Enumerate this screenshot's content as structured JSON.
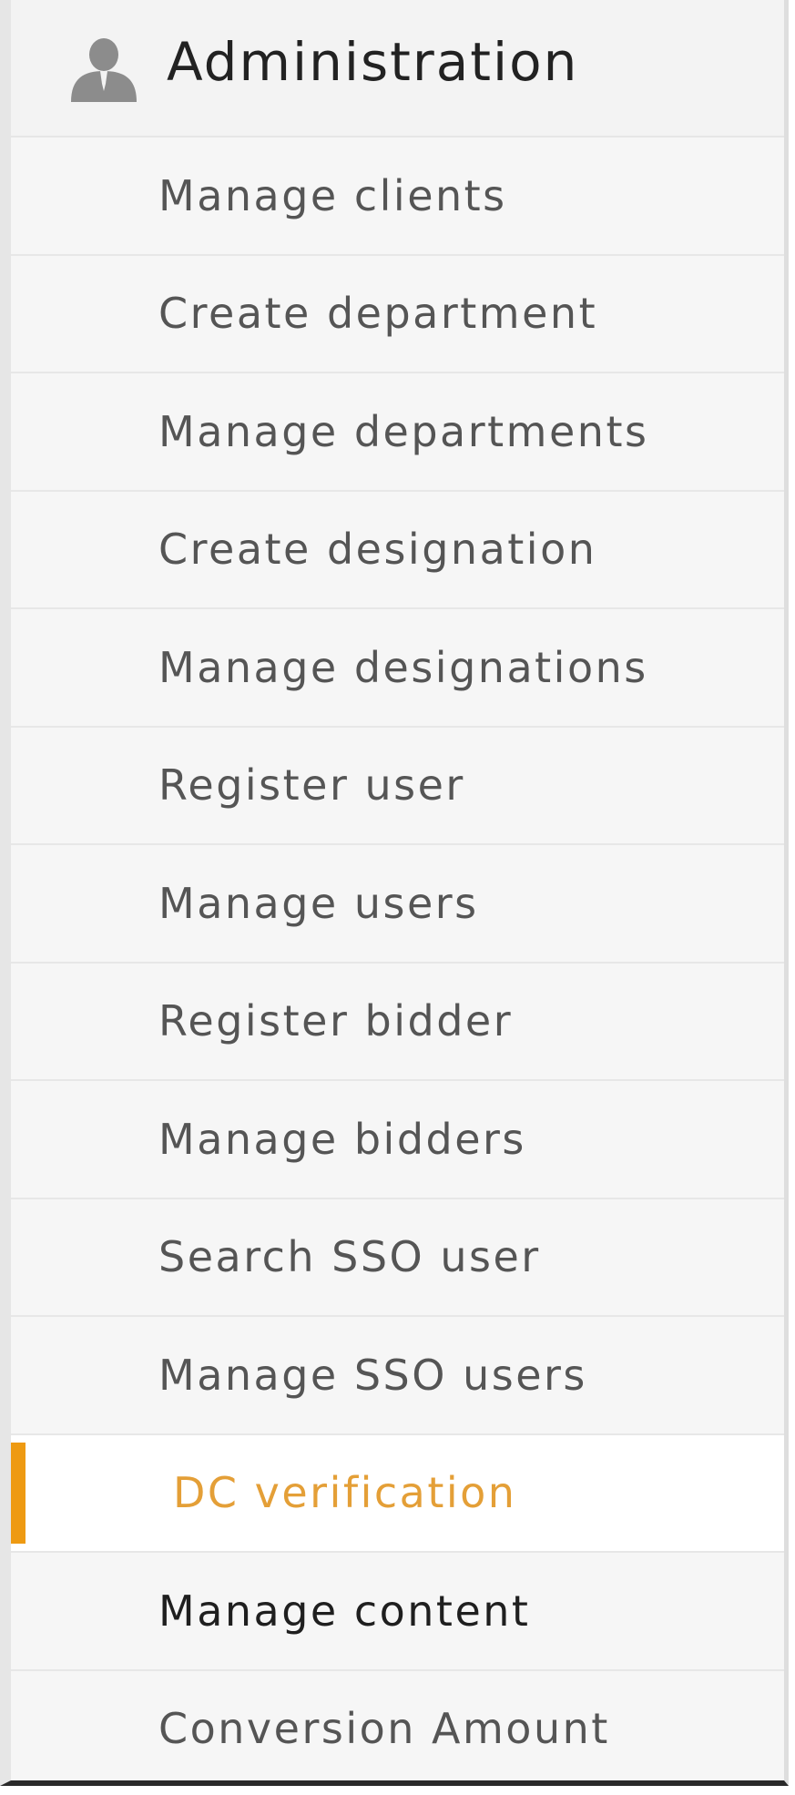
{
  "header": {
    "icon": "user-icon",
    "title": "Administration"
  },
  "menu": {
    "items": [
      {
        "label": "Manage clients",
        "state": "normal"
      },
      {
        "label": "Create department",
        "state": "normal"
      },
      {
        "label": "Manage departments",
        "state": "normal"
      },
      {
        "label": "Create designation",
        "state": "normal"
      },
      {
        "label": "Manage designations",
        "state": "normal"
      },
      {
        "label": "Register user",
        "state": "normal"
      },
      {
        "label": "Manage users",
        "state": "normal"
      },
      {
        "label": "Register bidder",
        "state": "normal"
      },
      {
        "label": "Manage bidders",
        "state": "normal"
      },
      {
        "label": "Search SSO user",
        "state": "normal"
      },
      {
        "label": "Manage SSO users",
        "state": "normal"
      },
      {
        "label": "DC verification",
        "state": "active"
      },
      {
        "label": "Manage content",
        "state": "hover"
      },
      {
        "label": "Conversion Amount",
        "state": "normal"
      }
    ]
  },
  "colors": {
    "accent": "#ee9a12",
    "active_text": "#e49f37",
    "text": "#555555",
    "hover_text": "#1f1f1f",
    "background": "#f6f6f6"
  }
}
